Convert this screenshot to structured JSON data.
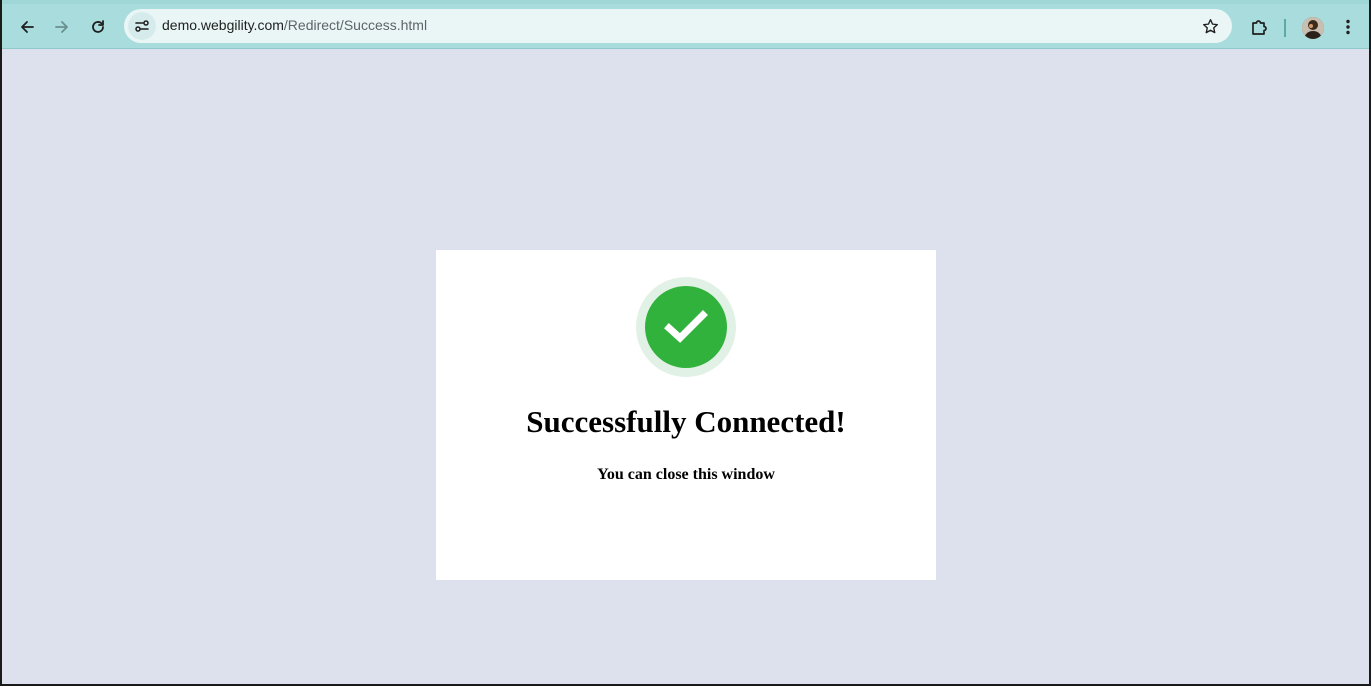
{
  "browser": {
    "url_host": "demo.webgility.com",
    "url_path": "/Redirect/Success.html",
    "toolbar_color": "#a9dcdc",
    "icons": {
      "back": "arrow-left-icon",
      "forward": "arrow-right-icon",
      "reload": "reload-icon",
      "site_info": "tune-icon",
      "bookmark": "star-icon",
      "extensions": "puzzle-icon",
      "profile": "avatar",
      "menu": "kebab-menu-icon"
    }
  },
  "page": {
    "background_color": "#dde1ee",
    "card": {
      "heading": "Successfully Connected!",
      "subtext": "You can close this window",
      "success_color": "#31b23c",
      "icon": "checkmark-icon"
    }
  }
}
